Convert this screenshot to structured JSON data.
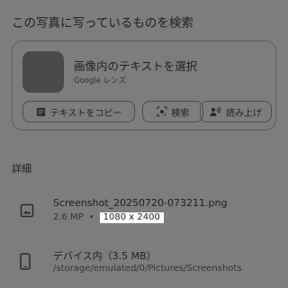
{
  "section": {
    "title": "この写真に写っているものを検索"
  },
  "lens": {
    "title": "画像内のテキストを選択",
    "subtitle": "Google レンズ",
    "actions": {
      "copy_text": "テキストをコピー",
      "search": "検索",
      "read_aloud": "読み上げ"
    }
  },
  "details": {
    "header": "詳細",
    "file": {
      "icon": "image-icon",
      "name": "Screenshot_20250720-073211.png",
      "size": "2.6 MP",
      "separator": "•",
      "resolution": "1080 x 2400"
    },
    "location": {
      "icon": "phone-icon",
      "label": "デバイス内（3.5 MB）",
      "path": "/storage/emulated/0/Pictures/Screenshots"
    }
  },
  "colors": {
    "background": "#7d7d7d",
    "thumbnail": "#494949",
    "highlight": "#ffffff"
  }
}
